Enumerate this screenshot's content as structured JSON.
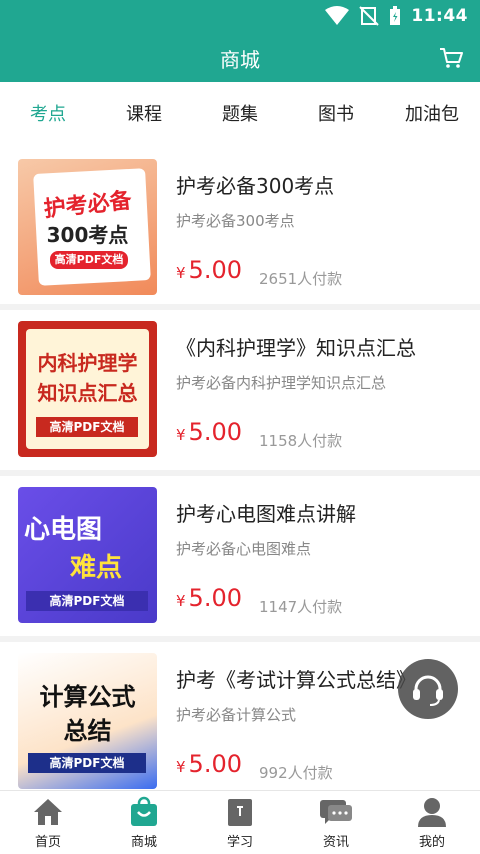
{
  "status": {
    "time": "11:44"
  },
  "appbar": {
    "title": "商城",
    "cart_icon": "cart-icon"
  },
  "tabs": [
    {
      "label": "考点",
      "active": true
    },
    {
      "label": "课程",
      "active": false
    },
    {
      "label": "题集",
      "active": false
    },
    {
      "label": "图书",
      "active": false
    },
    {
      "label": "加油包",
      "active": false
    }
  ],
  "products": [
    {
      "title": "护考必备300考点",
      "subtitle": "护考必备300考点",
      "currency": "¥",
      "price": "5.00",
      "buyers": "2651人付款",
      "thumb_lines": [
        "护考必备",
        "300考点",
        "高清PDF文档"
      ]
    },
    {
      "title": "《内科护理学》知识点汇总",
      "subtitle": "护考必备内科护理学知识点汇总",
      "currency": "¥",
      "price": "5.00",
      "buyers": "1158人付款",
      "thumb_lines": [
        "内科护理学",
        "知识点汇总",
        "高清PDF文档"
      ]
    },
    {
      "title": "护考心电图难点讲解",
      "subtitle": "护考必备心电图难点",
      "currency": "¥",
      "price": "5.00",
      "buyers": "1147人付款",
      "thumb_lines": [
        "心电图",
        "难点",
        "高清PDF文档"
      ]
    },
    {
      "title": "护考《考试计算公式总结》",
      "subtitle": "护考必备计算公式",
      "currency": "¥",
      "price": "5.00",
      "buyers": "992人付款",
      "thumb_lines": [
        "计算公式",
        "总结",
        "高清PDF文档"
      ]
    }
  ],
  "bottom_nav": [
    {
      "label": "首页",
      "icon": "home-icon",
      "active": false
    },
    {
      "label": "商城",
      "icon": "shop-bag-icon",
      "active": true
    },
    {
      "label": "学习",
      "icon": "book-icon",
      "active": false
    },
    {
      "label": "资讯",
      "icon": "chat-icon",
      "active": false
    },
    {
      "label": "我的",
      "icon": "user-icon",
      "active": false
    }
  ],
  "colors": {
    "primary": "#20a791",
    "price": "#e4232d"
  }
}
